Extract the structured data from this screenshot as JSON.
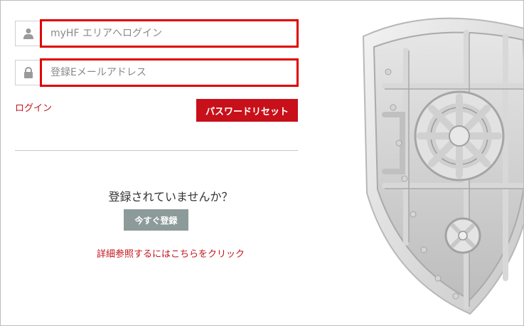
{
  "form": {
    "user_field": {
      "placeholder": "myHF エリアへログイン",
      "icon": "user-icon"
    },
    "email_field": {
      "placeholder": "登録Eメールアドレス",
      "icon": "lock-icon"
    },
    "login_link": "ログイン",
    "reset_button": "パスワードリセット"
  },
  "register": {
    "question": "登録されていませんか？",
    "button": "今すぐ登録",
    "details_link": "詳細参照するにはこちらをクリック"
  },
  "decoration": {
    "image": "vault-door-shield"
  },
  "colors": {
    "accent_red": "#c8101a",
    "highlight_red": "#e00000",
    "gray_button": "#8c9a9a",
    "link_red": "#c4141b"
  }
}
